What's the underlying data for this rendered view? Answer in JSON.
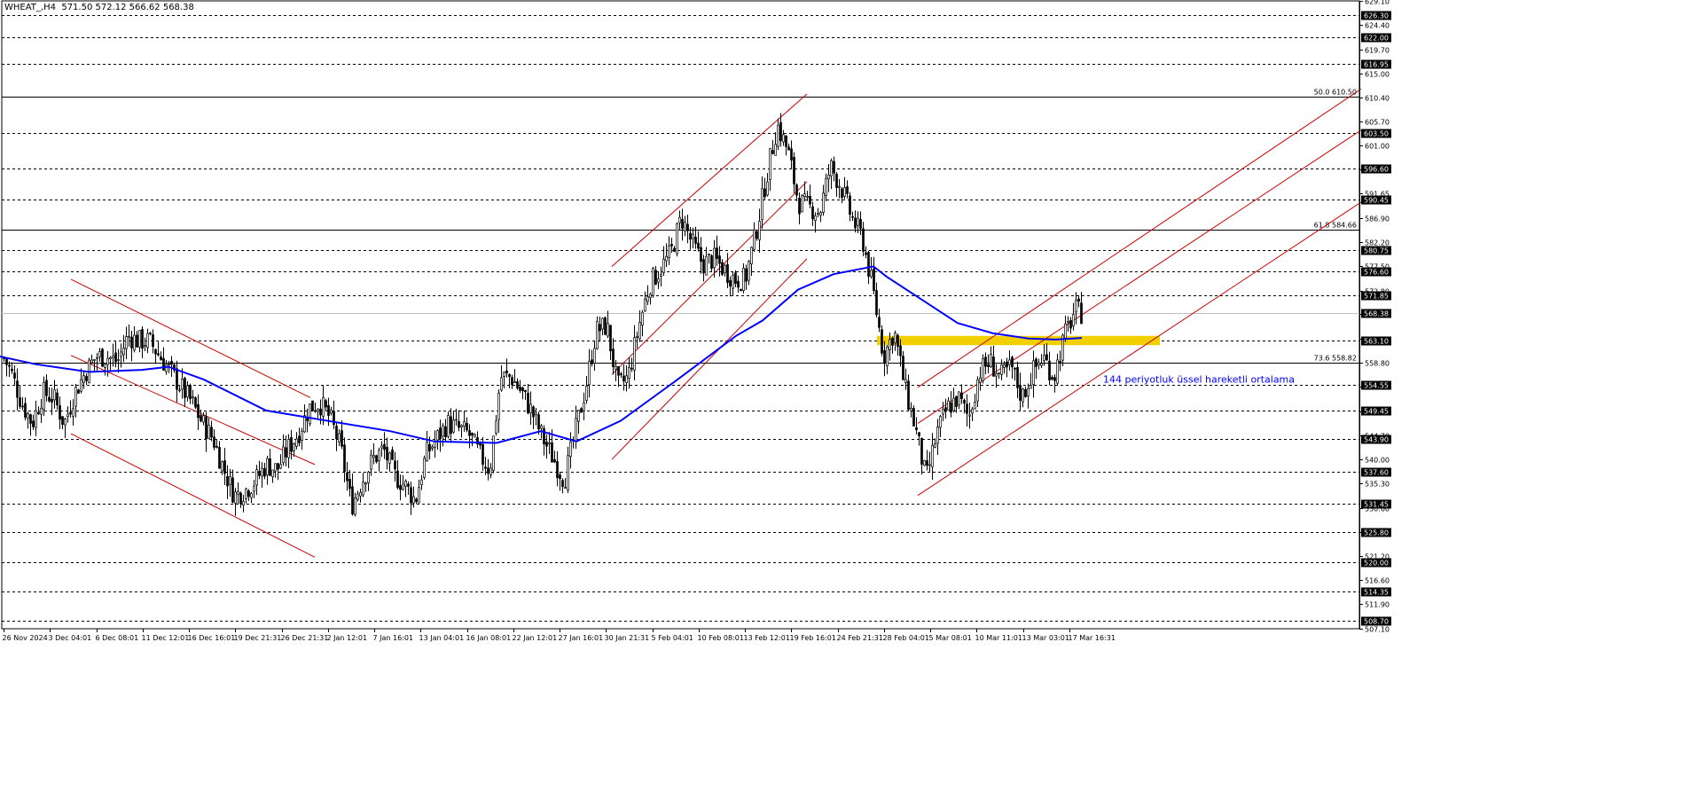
{
  "header": {
    "symbol": "WHEAT_,H4",
    "ohlc": "571.50 572.12 566.62 568.38"
  },
  "annotation": "144 periyotluk üssel hareketli ortalama",
  "colors": {
    "bull": "#000000",
    "bear": "#000000",
    "ema": "#0000ff",
    "channel": "#cc0000",
    "highlight": "#f2d000",
    "grid": "#000000",
    "bg": "#ffffff"
  },
  "chart_data": {
    "type": "candlestick",
    "symbol": "WHEAT_",
    "timeframe": "H4",
    "ylim": [
      507.1,
      629.1
    ],
    "price_axis_ticks": [
      629.1,
      624.4,
      619.7,
      615.0,
      610.4,
      605.7,
      601.0,
      596.35,
      591.65,
      586.9,
      582.2,
      577.5,
      572.8,
      568.2,
      563.5,
      558.8,
      554.1,
      549.4,
      544.7,
      540.0,
      535.3,
      530.6,
      525.9,
      521.2,
      516.6,
      511.9,
      507.1
    ],
    "level_lines": [
      {
        "value": 626.3,
        "label": "626.30"
      },
      {
        "value": 622.0,
        "label": "622.00"
      },
      {
        "value": 616.95,
        "label": "616.95"
      },
      {
        "value": 603.5,
        "label": "603.50"
      },
      {
        "value": 596.6,
        "label": "596.60"
      },
      {
        "value": 590.45,
        "label": "590.45"
      },
      {
        "value": 580.75,
        "label": "580.75"
      },
      {
        "value": 576.6,
        "label": "576.60"
      },
      {
        "value": 571.85,
        "label": "571.85"
      },
      {
        "value": 563.1,
        "label": "563.10"
      },
      {
        "value": 554.55,
        "label": "554.55"
      },
      {
        "value": 549.45,
        "label": "549.45"
      },
      {
        "value": 543.9,
        "label": "543.90"
      },
      {
        "value": 537.6,
        "label": "537.60"
      },
      {
        "value": 531.45,
        "label": "531.45"
      },
      {
        "value": 525.8,
        "label": "525.80"
      },
      {
        "value": 520.0,
        "label": "520.00"
      },
      {
        "value": 514.35,
        "label": "514.35"
      },
      {
        "value": 508.7,
        "label": "508.70"
      }
    ],
    "fib_levels": [
      {
        "value": 610.5,
        "label": "50.0 610.50"
      },
      {
        "value": 584.66,
        "label": "61.8 584.66"
      },
      {
        "value": 558.82,
        "label": "73.6 558.82"
      }
    ],
    "current_price": {
      "value": 568.38,
      "label": "568.38"
    },
    "time_labels": [
      "26 Nov 2024",
      "3 Dec 04:01",
      "6 Dec 08:01",
      "11 Dec 12:01",
      "16 Dec 16:01",
      "19 Dec 21:31",
      "26 Dec 21:31",
      "2 Jan 12:01",
      "7 Jan 16:01",
      "13 Jan 04:01",
      "16 Jan 08:01",
      "22 Jan 12:01",
      "27 Jan 16:01",
      "30 Jan 21:31",
      "5 Feb 04:01",
      "10 Feb 08:01",
      "13 Feb 12:01",
      "19 Feb 16:01",
      "24 Feb 21:31",
      "28 Feb 04:01",
      "5 Mar 08:01",
      "10 Mar 11:01",
      "13 Mar 03:01",
      "17 Mar 16:31"
    ],
    "close_path": [
      [
        0,
        561
      ],
      [
        12,
        557
      ],
      [
        24,
        551
      ],
      [
        36,
        547
      ],
      [
        48,
        553
      ],
      [
        60,
        552
      ],
      [
        72,
        547
      ],
      [
        84,
        553
      ],
      [
        96,
        557
      ],
      [
        108,
        560
      ],
      [
        120,
        560
      ],
      [
        132,
        559
      ],
      [
        144,
        564
      ],
      [
        156,
        563
      ],
      [
        168,
        563
      ],
      [
        180,
        560
      ],
      [
        192,
        557
      ],
      [
        204,
        554
      ],
      [
        216,
        551
      ],
      [
        228,
        547
      ],
      [
        240,
        544
      ],
      [
        252,
        538
      ],
      [
        264,
        533
      ],
      [
        276,
        534
      ],
      [
        288,
        536
      ],
      [
        300,
        539
      ],
      [
        312,
        538
      ],
      [
        324,
        542
      ],
      [
        336,
        545
      ],
      [
        348,
        550
      ],
      [
        360,
        551
      ],
      [
        372,
        548
      ],
      [
        384,
        542
      ],
      [
        396,
        531
      ],
      [
        408,
        536
      ],
      [
        420,
        540
      ],
      [
        432,
        542
      ],
      [
        444,
        537
      ],
      [
        456,
        535
      ],
      [
        468,
        532
      ],
      [
        480,
        541
      ],
      [
        492,
        544
      ],
      [
        504,
        547
      ],
      [
        516,
        546
      ],
      [
        528,
        545
      ],
      [
        540,
        541
      ],
      [
        552,
        538
      ],
      [
        564,
        556
      ],
      [
        576,
        556
      ],
      [
        588,
        553
      ],
      [
        600,
        549
      ],
      [
        612,
        544
      ],
      [
        624,
        540
      ],
      [
        636,
        536
      ],
      [
        648,
        545
      ],
      [
        660,
        554
      ],
      [
        672,
        565
      ],
      [
        684,
        566
      ],
      [
        696,
        554
      ],
      [
        708,
        556
      ],
      [
        720,
        566
      ],
      [
        732,
        574
      ],
      [
        744,
        577
      ],
      [
        756,
        580
      ],
      [
        768,
        587
      ],
      [
        780,
        582
      ],
      [
        792,
        578
      ],
      [
        804,
        579
      ],
      [
        816,
        577
      ],
      [
        828,
        575
      ],
      [
        840,
        575
      ],
      [
        852,
        584
      ],
      [
        864,
        595
      ],
      [
        876,
        605
      ],
      [
        888,
        600
      ],
      [
        900,
        590
      ],
      [
        912,
        589
      ],
      [
        924,
        588
      ],
      [
        936,
        597
      ],
      [
        948,
        593
      ],
      [
        960,
        587
      ],
      [
        972,
        583
      ],
      [
        984,
        573
      ],
      [
        996,
        560
      ],
      [
        1008,
        565
      ],
      [
        1020,
        554
      ],
      [
        1032,
        546
      ],
      [
        1044,
        536
      ],
      [
        1056,
        545
      ],
      [
        1068,
        550
      ],
      [
        1080,
        552
      ],
      [
        1092,
        548
      ],
      [
        1104,
        557
      ],
      [
        1116,
        559
      ],
      [
        1128,
        556
      ],
      [
        1140,
        558
      ],
      [
        1152,
        552
      ],
      [
        1164,
        557
      ],
      [
        1176,
        560
      ],
      [
        1188,
        556
      ],
      [
        1200,
        564
      ],
      [
        1212,
        569
      ],
      [
        1220,
        568.4
      ]
    ],
    "ema_144": [
      [
        0,
        560
      ],
      [
        40,
        558.5
      ],
      [
        100,
        557
      ],
      [
        160,
        557.4
      ],
      [
        190,
        558
      ],
      [
        230,
        555.5
      ],
      [
        300,
        549.5
      ],
      [
        380,
        547.2
      ],
      [
        440,
        545.5
      ],
      [
        490,
        543.5
      ],
      [
        560,
        543.2
      ],
      [
        610,
        545.5
      ],
      [
        650,
        543.5
      ],
      [
        700,
        547.5
      ],
      [
        760,
        555
      ],
      [
        830,
        564
      ],
      [
        860,
        567
      ],
      [
        900,
        573
      ],
      [
        940,
        576
      ],
      [
        985,
        577.5
      ],
      [
        1000,
        575.5
      ],
      [
        1040,
        571
      ],
      [
        1080,
        566.5
      ],
      [
        1120,
        564.5
      ],
      [
        1160,
        563.5
      ],
      [
        1190,
        563.3
      ],
      [
        1220,
        563.6
      ]
    ],
    "channels": [
      {
        "name": "down-1",
        "start": [
          80,
          575
        ],
        "end": [
          350,
          552
        ]
      },
      {
        "name": "down-2",
        "start": [
          80,
          560.2
        ],
        "end": [
          355,
          539
        ]
      },
      {
        "name": "down-3",
        "start": [
          80,
          545
        ],
        "end": [
          355,
          521
        ]
      },
      {
        "name": "up-1",
        "start": [
          690,
          577.5
        ],
        "end": [
          910,
          611
        ]
      },
      {
        "name": "up-2",
        "start": [
          690,
          556.5
        ],
        "end": [
          910,
          594
        ]
      },
      {
        "name": "up-3",
        "start": [
          690,
          540
        ],
        "end": [
          910,
          579
        ]
      },
      {
        "name": "up-4",
        "start": [
          1035,
          554
        ],
        "end": [
          1535,
          612
        ]
      },
      {
        "name": "up-5",
        "start": [
          1035,
          547
        ],
        "end": [
          1535,
          604
        ]
      },
      {
        "name": "up-6",
        "start": [
          1035,
          533
        ],
        "end": [
          1535,
          590
        ]
      }
    ],
    "highlight_zone": {
      "from": 562.2,
      "to": 564.0,
      "x_start": 989,
      "x_end": 1308
    }
  }
}
